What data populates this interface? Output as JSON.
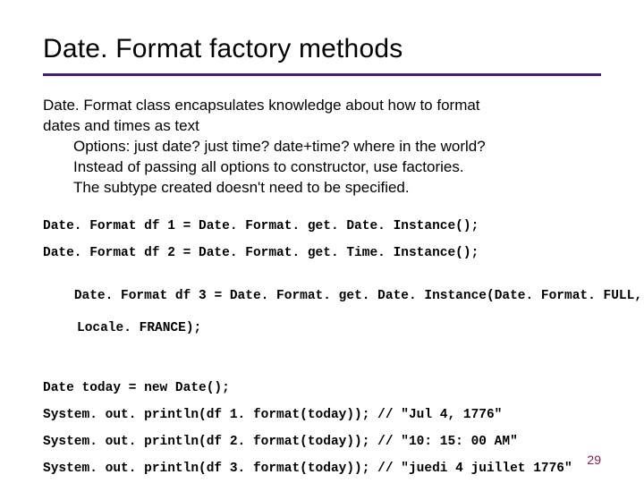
{
  "title": "Date. Format factory methods",
  "intro": {
    "lead1": "Date. Format class encapsulates knowledge about how to format",
    "lead2": "dates and times as text",
    "opt1": "Options: just date? just time? date+time? where in the world?",
    "opt2": "Instead of passing all options to constructor, use factories.",
    "opt3": "The subtype created doesn't need to be specified."
  },
  "code": {
    "l1": "Date. Format df 1 = Date. Format. get. Date. Instance();",
    "l2": "Date. Format df 2 = Date. Format. get. Time. Instance();",
    "l3a": "Date. Format df 3 = Date. Format. get. Date. Instance(Date. Format. FULL,",
    "l3b": "Locale. FRANCE);",
    "l4": "Date today = new Date();",
    "l5": "System. out. println(df 1. format(today)); // \"Jul 4, 1776\"",
    "l6": "System. out. println(df 2. format(today)); // \"10: 15: 00 AM\"",
    "l7": "System. out. println(df 3. format(today)); // \"juedi 4 juillet 1776\""
  },
  "page": "29"
}
